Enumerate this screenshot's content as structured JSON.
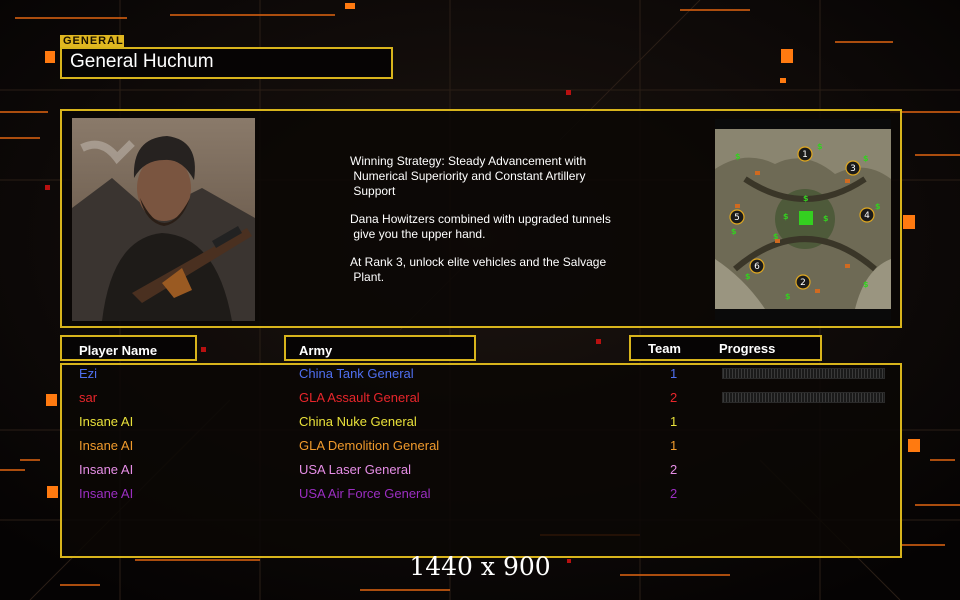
{
  "general_tag": "GENERAL",
  "general_name": "General Huchum",
  "strategy": [
    "Winning Strategy: Steady Advancement with\n Numerical Superiority and Constant Artillery\n Support",
    "Dana Howitzers combined with upgraded tunnels\n give you the upper hand.",
    "At Rank 3, unlock elite vehicles and the Salvage\n Plant."
  ],
  "headers": {
    "player_name": "Player Name",
    "army": "Army",
    "team": "Team",
    "progress": "Progress"
  },
  "players": [
    {
      "name": "Ezi",
      "army": "China Tank General",
      "team": "1",
      "color": "#4f6ff0",
      "progress": true,
      "progress_value": 0
    },
    {
      "name": "sar",
      "army": "GLA Assault General",
      "team": "2",
      "color": "#e8262b",
      "progress": true,
      "progress_value": 0
    },
    {
      "name": "Insane AI",
      "army": "China Nuke General",
      "team": "1",
      "color": "#e9e13a",
      "progress": false
    },
    {
      "name": "Insane AI",
      "army": "GLA Demolition General",
      "team": "1",
      "color": "#f09a2c",
      "progress": false
    },
    {
      "name": "Insane AI",
      "army": "USA Laser General",
      "team": "2",
      "color": "#e68ee6",
      "progress": false
    },
    {
      "name": "Insane AI",
      "army": "USA Air Force General",
      "team": "2",
      "color": "#9b2ec2",
      "progress": false
    }
  ],
  "map_start_positions": [
    "1",
    "2",
    "3",
    "4",
    "5",
    "6"
  ],
  "resolution": "1440 x 900",
  "colors": {
    "accent": "#d8b41c",
    "highlight": "#ff7a10"
  }
}
